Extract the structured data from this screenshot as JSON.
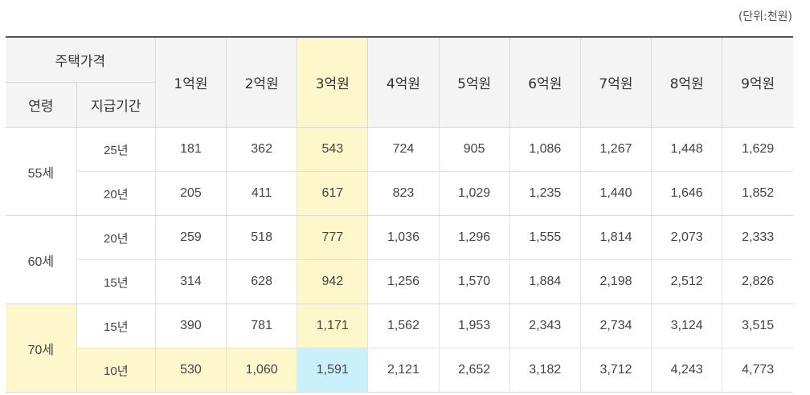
{
  "unit_note": "(단위:천원)",
  "header": {
    "house_price": "주택가격",
    "age": "연령",
    "payment_period": "지급기간",
    "prices": [
      "1억원",
      "2억원",
      "3억원",
      "4억원",
      "5억원",
      "6억원",
      "7억원",
      "8억원",
      "9억원"
    ]
  },
  "groups": [
    {
      "age": "55세",
      "rows": [
        {
          "period": "25년",
          "values": [
            "181",
            "362",
            "543",
            "724",
            "905",
            "1,086",
            "1,267",
            "1,448",
            "1,629"
          ]
        },
        {
          "period": "20년",
          "values": [
            "205",
            "411",
            "617",
            "823",
            "1,029",
            "1,235",
            "1,440",
            "1,646",
            "1,852"
          ]
        }
      ]
    },
    {
      "age": "60세",
      "rows": [
        {
          "period": "20년",
          "values": [
            "259",
            "518",
            "777",
            "1,036",
            "1,296",
            "1,555",
            "1,814",
            "2,073",
            "2,333"
          ]
        },
        {
          "period": "15년",
          "values": [
            "314",
            "628",
            "942",
            "1,256",
            "1,570",
            "1,884",
            "2,198",
            "2,512",
            "2,826"
          ]
        }
      ]
    },
    {
      "age": "70세",
      "rows": [
        {
          "period": "15년",
          "values": [
            "390",
            "781",
            "1,171",
            "1,562",
            "1,953",
            "2,343",
            "2,734",
            "3,124",
            "3,515"
          ]
        },
        {
          "period": "10년",
          "values": [
            "530",
            "1,060",
            "1,591",
            "2,121",
            "2,652",
            "3,182",
            "3,712",
            "4,243",
            "4,773"
          ]
        }
      ]
    }
  ],
  "colors": {
    "highlight_yellow": "#fff7cc",
    "highlight_cyan": "#c8f1fb",
    "header_bg": "#f4f4f4"
  }
}
